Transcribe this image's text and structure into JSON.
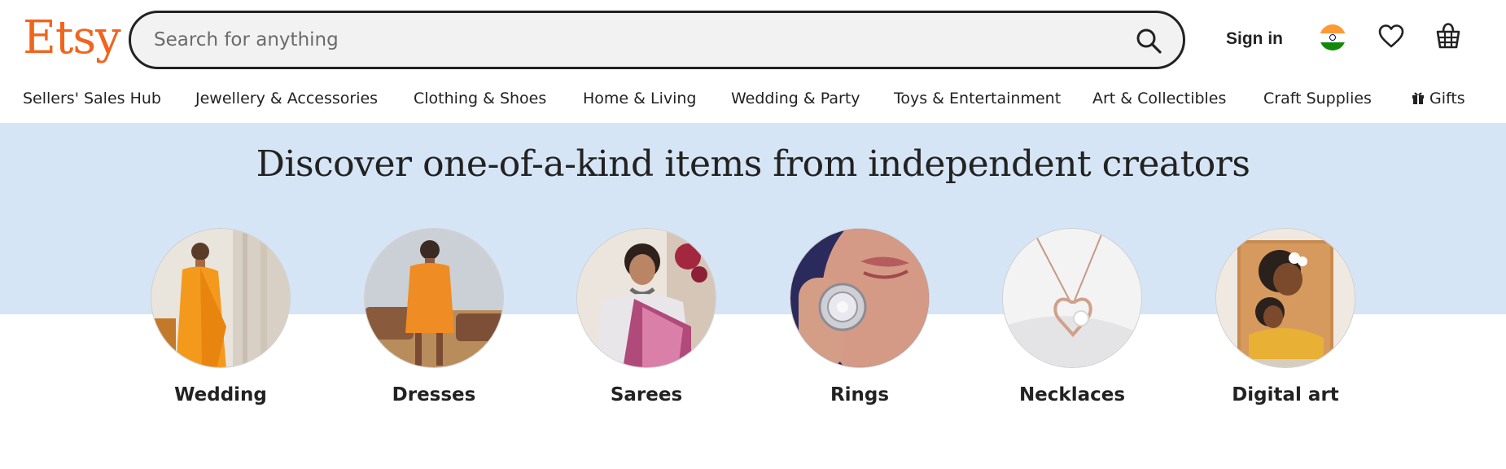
{
  "header": {
    "logo": "Etsy",
    "search_placeholder": "Search for anything",
    "sign_in": "Sign in",
    "icons": {
      "search": "search-icon",
      "flag": "india-flag-icon",
      "favorites": "heart-icon",
      "cart": "basket-icon"
    }
  },
  "nav": {
    "items": [
      {
        "label": "Sellers' Sales Hub"
      },
      {
        "label": "Jewellery & Accessories"
      },
      {
        "label": "Clothing & Shoes"
      },
      {
        "label": "Home & Living"
      },
      {
        "label": "Wedding & Party"
      },
      {
        "label": "Toys & Entertainment"
      },
      {
        "label": "Art & Collectibles"
      },
      {
        "label": "Craft Supplies"
      },
      {
        "label": "Gifts",
        "icon": "gift-icon"
      }
    ]
  },
  "hero": {
    "headline": "Discover one-of-a-kind items from independent creators",
    "categories": [
      {
        "label": "Wedding"
      },
      {
        "label": "Dresses"
      },
      {
        "label": "Sarees"
      },
      {
        "label": "Rings"
      },
      {
        "label": "Necklaces"
      },
      {
        "label": "Digital art"
      }
    ]
  },
  "colors": {
    "brand": "#F1641E",
    "hero_bg": "#D6E5F5",
    "text": "#222222"
  }
}
